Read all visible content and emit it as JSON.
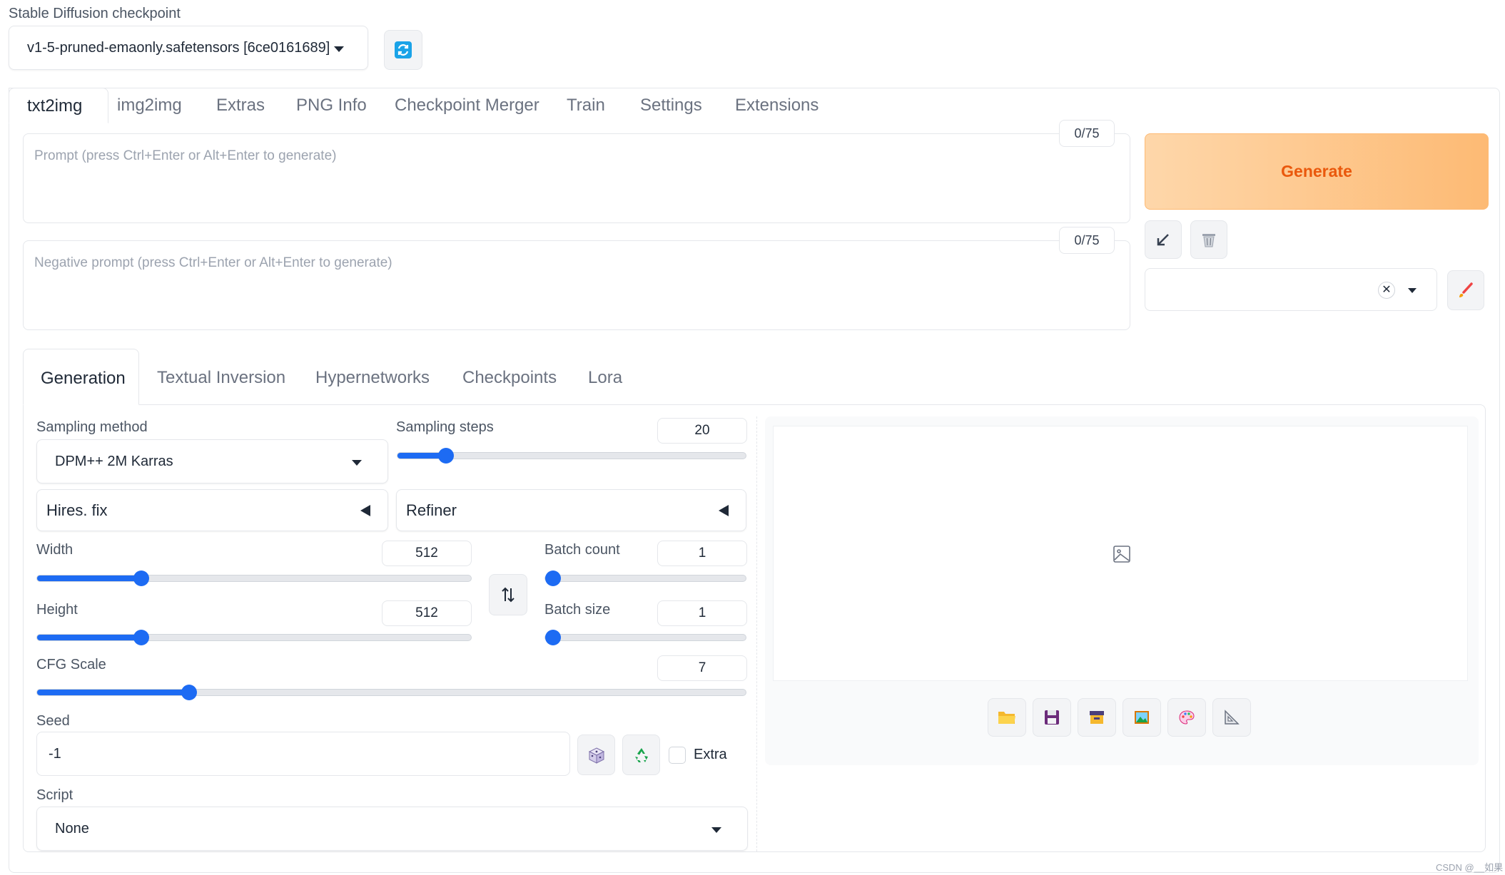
{
  "checkpoint": {
    "label": "Stable Diffusion checkpoint",
    "value": "v1-5-pruned-emaonly.safetensors [6ce0161689]"
  },
  "main_tabs": [
    {
      "label": "txt2img"
    },
    {
      "label": "img2img"
    },
    {
      "label": "Extras"
    },
    {
      "label": "PNG Info"
    },
    {
      "label": "Checkpoint Merger"
    },
    {
      "label": "Train"
    },
    {
      "label": "Settings"
    },
    {
      "label": "Extensions"
    }
  ],
  "prompt": {
    "placeholder": "Prompt (press Ctrl+Enter or Alt+Enter to generate)",
    "counter": "0/75"
  },
  "negative_prompt": {
    "placeholder": "Negative prompt (press Ctrl+Enter or Alt+Enter to generate)",
    "counter": "0/75"
  },
  "generate_label": "Generate",
  "sub_tabs": [
    {
      "label": "Generation"
    },
    {
      "label": "Textual Inversion"
    },
    {
      "label": "Hypernetworks"
    },
    {
      "label": "Checkpoints"
    },
    {
      "label": "Lora"
    }
  ],
  "sampling_method": {
    "label": "Sampling method",
    "value": "DPM++ 2M Karras"
  },
  "sampling_steps": {
    "label": "Sampling steps",
    "value": "20",
    "fraction": 0.14
  },
  "hires_fix": {
    "label": "Hires. fix"
  },
  "refiner": {
    "label": "Refiner"
  },
  "width": {
    "label": "Width",
    "value": "512",
    "fraction": 0.24
  },
  "height": {
    "label": "Height",
    "value": "512",
    "fraction": 0.24
  },
  "batch_count": {
    "label": "Batch count",
    "value": "1",
    "fraction": 0.0
  },
  "batch_size": {
    "label": "Batch size",
    "value": "1",
    "fraction": 0.0
  },
  "cfg_scale": {
    "label": "CFG Scale",
    "value": "7",
    "fraction": 0.215
  },
  "seed": {
    "label": "Seed",
    "value": "-1",
    "extra_label": "Extra"
  },
  "script": {
    "label": "Script",
    "value": "None"
  },
  "watermark": "CSDN @__如果",
  "colors": {
    "accent": "#1d6bf3",
    "generate_text": "#ea580c",
    "generate_from": "#fed7aa",
    "generate_to": "#fdba74"
  }
}
